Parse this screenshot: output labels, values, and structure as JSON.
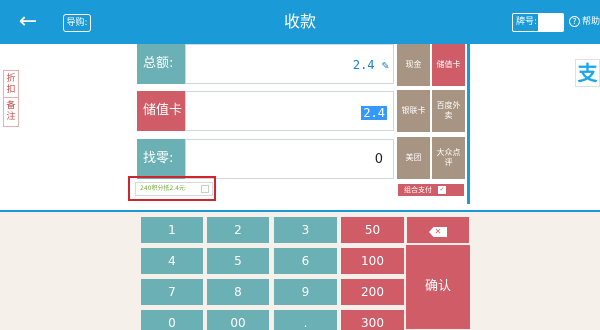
{
  "header": {
    "back_icon": "arrow-left-icon",
    "guide_label": "导购:",
    "title": "收款",
    "plate_label": "牌号:",
    "plate_value": "",
    "help_label": "帮助",
    "help_icon": "question-circle-icon"
  },
  "side_tabs": [
    "折扣",
    "备注"
  ],
  "fields": {
    "total_label": "总额:",
    "total_value": "2.4",
    "stored_label": "储值卡",
    "stored_value": "2.4",
    "change_label": "找零:",
    "change_value": "0"
  },
  "pay_methods": [
    {
      "label": "现金",
      "active": false
    },
    {
      "label": "储值卡",
      "active": true
    },
    {
      "label": "银联卡",
      "active": false
    },
    {
      "label": "百度外卖",
      "active": false
    },
    {
      "label": "美团",
      "active": false
    },
    {
      "label": "大众点评",
      "active": false
    }
  ],
  "combo_pay_label": "组合支付",
  "points_text": "240积分抵2.4元",
  "alipay_glyph": "支",
  "keypad": {
    "digits": [
      "1",
      "2",
      "3",
      "4",
      "5",
      "6",
      "7",
      "8",
      "9",
      "0",
      "00",
      "."
    ],
    "amounts": [
      "50",
      "100",
      "200",
      "300"
    ],
    "confirm_label": "确认"
  },
  "colors": {
    "header_blue": "#1a9ad6",
    "teal": "#6ab0b4",
    "red": "#cf5c67",
    "tan": "#a89482"
  }
}
